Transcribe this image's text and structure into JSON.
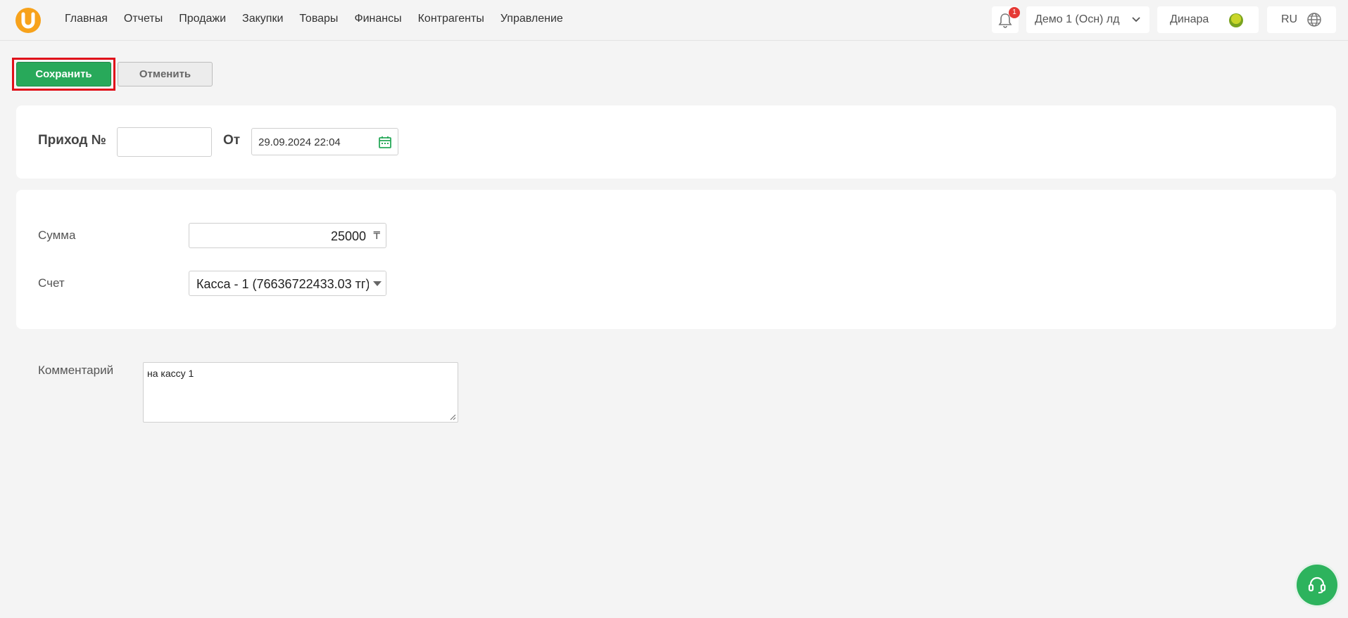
{
  "header": {
    "nav": [
      "Главная",
      "Отчеты",
      "Продажи",
      "Закупки",
      "Товары",
      "Финансы",
      "Контрагенты",
      "Управление"
    ],
    "notification_count": "1",
    "organization": "Демо 1 (Осн) лд",
    "user": "Динара",
    "language": "RU"
  },
  "actions": {
    "save_label": "Сохранить",
    "cancel_label": "Отменить"
  },
  "doc": {
    "number_label": "Приход №",
    "number_value": "",
    "from_label": "От",
    "date_value": "29.09.2024 22:04"
  },
  "form": {
    "sum_label": "Сумма",
    "sum_value": "25000",
    "currency_symbol": "₸",
    "account_label": "Счет",
    "account_value": "Касса - 1 (76636722433.03 тг)",
    "comment_label": "Комментарий",
    "comment_value": "на кассу 1"
  },
  "colors": {
    "accent_green": "#28a95a",
    "logo_orange": "#f7a21b",
    "badge_red": "#e53935",
    "highlight_red": "#e0101a"
  }
}
